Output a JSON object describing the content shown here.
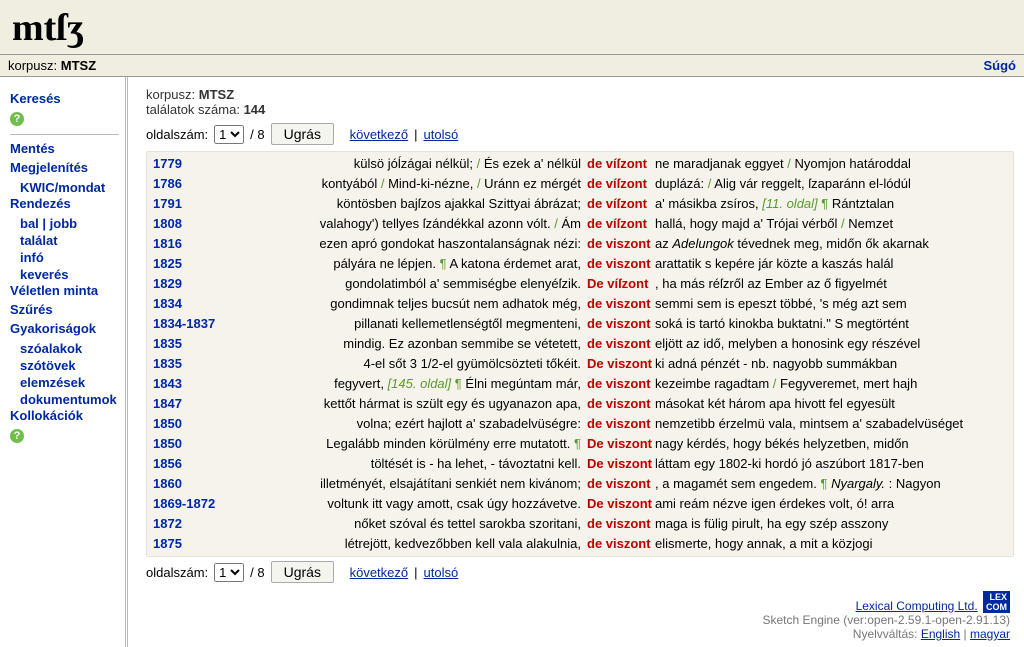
{
  "app": {
    "logo": "mtſʒ",
    "corpus_label": "korpusz:",
    "corpus_name": "MTSZ",
    "help": "Súgó"
  },
  "sidebar": {
    "search": "Keresés",
    "save": "Mentés",
    "display": "Megjelenítés",
    "kwic": "KWIC/mondat",
    "sort": "Rendezés",
    "sort_items": [
      "bal | jobb",
      "találat",
      "infó",
      "keverés"
    ],
    "sample": "Véletlen minta",
    "filter": "Szűrés",
    "freq": "Gyakoriságok",
    "freq_items": [
      "szóalakok",
      "szótövek",
      "elemzések",
      "dokumentumok"
    ],
    "colloc": "Kollokációk"
  },
  "meta": {
    "corpus_label": "korpusz:",
    "corpus_name": "MTSZ",
    "hits_label": "találatok száma:",
    "hits": "144"
  },
  "pager": {
    "page_label": "oldalszám:",
    "page": "1",
    "of": "/ 8",
    "go": "Ugrás",
    "next": "következő",
    "last": "utolsó",
    "sep": "|"
  },
  "rows": [
    {
      "year": "1779",
      "left": "külsö jóĺzágai nélkül; <s>/</s> És ezek a' nélkül",
      "kw": "de víſzont",
      "right": "ne maradjanak eggyet <s>/</s> Nyomjon határoddal"
    },
    {
      "year": "1786",
      "left": "kontyából <s>/</s> Mind-ki-nézne, <s>/</s> Uránn ez mérgét",
      "kw": "de víſzont",
      "right": "duplázá: <s>/</s> Alig vár reggelt, ſzaparánn el-lódúl"
    },
    {
      "year": "1791",
      "left": "köntösben bajſzos ajakkal Szittyai ábrázat;",
      "kw": "de víſzont",
      "right": "a' másikba zsíros, <g>[11. oldal]</g> <p>¶</p> Rántztalan"
    },
    {
      "year": "1808",
      "left": "valahogy') tellyes ſzándékkal azonn vólt. <s>/</s> Ám",
      "kw": "de víſzont",
      "right": "hallá, hogy majd a' Trójai vérből <s>/</s> Nemzet"
    },
    {
      "year": "1816",
      "left": "ezen apró gondokat haszontalanságnak nézi:",
      "kw": "de viszont",
      "right": "az <i>Adelungok</i> tévednek meg, midőn ők akarnak"
    },
    {
      "year": "1825",
      "left": "pályára ne lépjen. <p>¶</p> A katona érdemet arat,",
      "kw": "de viszont",
      "right": "arattatik s kepére jár közte a kaszás halál"
    },
    {
      "year": "1829",
      "left": "gondolatimból a' semmiségbe elenyéſzik.",
      "kw": "De víſzont",
      "right": ", ha más réſzről az Ember az ő figyelmét"
    },
    {
      "year": "1834",
      "left": "gondimnak teljes bucsút nem adhatok még,",
      "kw": "de viszont",
      "right": "semmi sem is epeszt többé, 's még azt sem"
    },
    {
      "year": "1834-1837",
      "left": "pillanati kellemetlenségtől megmenteni,",
      "kw": "de viszont",
      "right": "soká is tartó kinokba buktatni.\" S megtörtént"
    },
    {
      "year": "1835",
      "left": "mindig. Ez azonban semmibe se vétetett,",
      "kw": "de viszont",
      "right": "eljött az idő, melyben a honosink egy részével"
    },
    {
      "year": "1835",
      "left": "4-el sőt 3 1/2-el gyümölcsözteti tőkéit.",
      "kw": "De viszont",
      "right": "ki adná pénzét - nb. nagyobb summákban"
    },
    {
      "year": "1843",
      "left": "fegyvert, <g>[145. oldal]</g> <p>¶</p> Élni megúntam már,",
      "kw": "de viszont",
      "right": "kezeimbe ragadtam <s>/</s> Fegyveremet, mert hajh"
    },
    {
      "year": "1847",
      "left": "kettőt hármat is szült egy és ugyanazon apa,",
      "kw": "de viszont",
      "right": "másokat két három apa hivott fel egyesült"
    },
    {
      "year": "1850",
      "left": "volna; ezért hajlott a' szabadelvüségre:",
      "kw": "de viszont",
      "right": "nemzetibb érzelmü vala, mintsem a' szabadelvüséget"
    },
    {
      "year": "1850",
      "left": "Legalább minden körülmény erre mutatott. <p>¶</p>",
      "kw": "De viszont",
      "right": "nagy kérdés, hogy békés helyzetben, midőn"
    },
    {
      "year": "1856",
      "left": "töltését is - ha lehet, - távoztatni kell.",
      "kw": "De viszont",
      "right": "láttam egy 1802-ki hordó jó aszúbort 1817-ben"
    },
    {
      "year": "1860",
      "left": "illetményét, elsajátítani senkiét nem kivánom;",
      "kw": "de viszont",
      "right": ", a magamét sem engedem. <p>¶</p> <i>Nyargaly.</i> : Nagyon"
    },
    {
      "year": "1869-1872",
      "left": "voltunk itt vagy amott, csak úgy hozzávetve.",
      "kw": "De viszont",
      "right": "ami reám nézve igen érdekes volt, ó! arra"
    },
    {
      "year": "1872",
      "left": "nőket szóval és tettel sarokba szoritani,",
      "kw": "de viszont",
      "right": "maga is fülig pirult, ha egy szép asszony"
    },
    {
      "year": "1875",
      "left": "létrejött, kedvezőbben kell vala alakulnia,",
      "kw": "de viszont",
      "right": "elismerte, hogy annak, a mit a közjogi"
    }
  ],
  "footer": {
    "company": "Lexical Computing Ltd.",
    "engine": "Sketch Engine (ver:open-2.59.1-open-2.91.13)",
    "lang_label": "Nyelvváltás:",
    "lang1": "English",
    "lang2": "magyar",
    "sep": "|",
    "badge1": "LEX",
    "badge2": "COM"
  }
}
